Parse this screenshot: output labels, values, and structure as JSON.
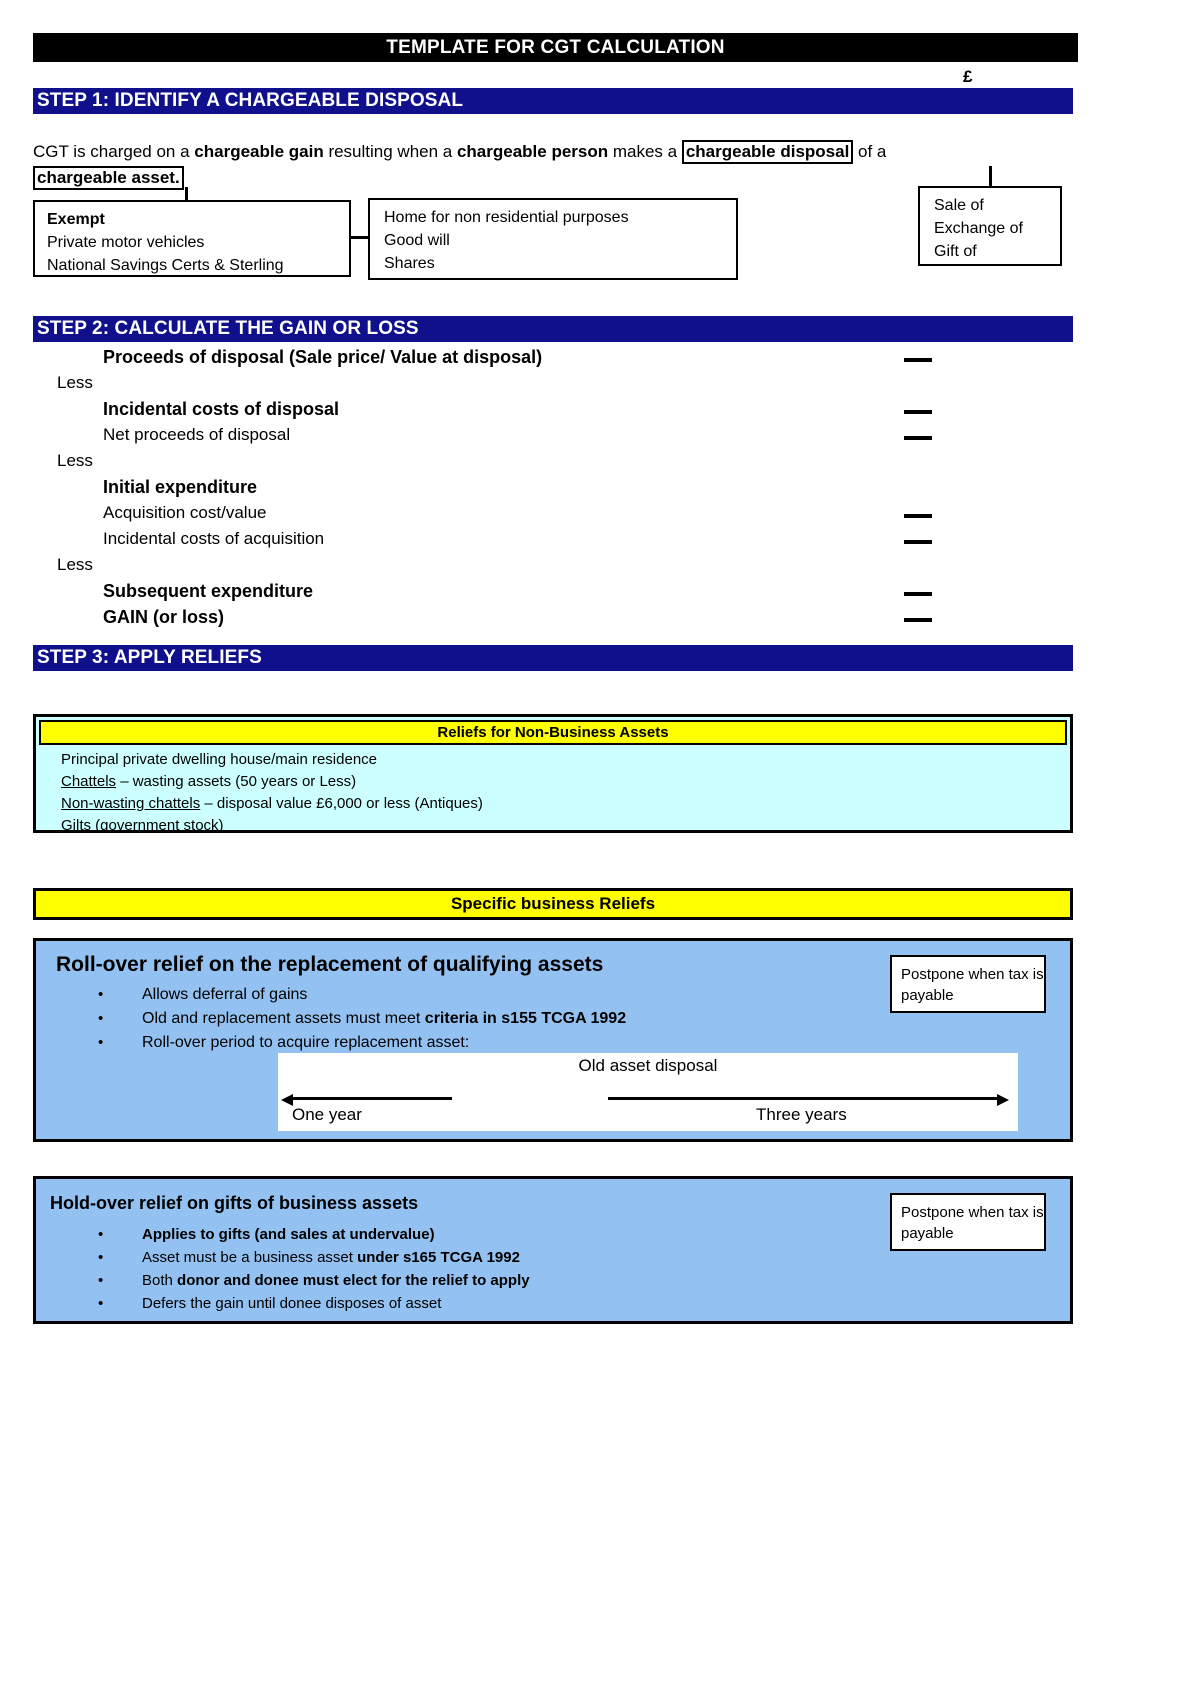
{
  "document": {
    "title": "TEMPLATE FOR CGT CALCULATION",
    "currency_symbol": "£"
  },
  "step1": {
    "heading": "STEP 1: IDENTIFY A CHARGEABLE DISPOSAL",
    "intro": {
      "p1": "CGT is charged on a ",
      "b1": "chargeable gain",
      "p2": " resulting when a ",
      "b2": "chargeable person",
      "p3": " makes a ",
      "boxed1": "chargeable disposal",
      "p4": " of a ",
      "boxed2": "chargeable asset."
    },
    "exempt_box": {
      "heading": "Exempt",
      "items": [
        "Private motor vehicles",
        "National Savings Certs & Sterling"
      ]
    },
    "home_box": {
      "items": [
        "Home for non residential purposes",
        "Good will",
        "Shares"
      ]
    },
    "disposal_box": {
      "items": [
        "Sale of",
        "Exchange of",
        "Gift of"
      ]
    }
  },
  "step2": {
    "heading": "STEP 2: CALCULATE THE GAIN OR LOSS",
    "rows": [
      {
        "less": "",
        "item": "Proceeds of disposal (Sale price/ Value at disposal)",
        "bold": true,
        "rule": true
      },
      {
        "less": "Less",
        "item": "",
        "bold": false,
        "rule": false
      },
      {
        "less": "",
        "item": "Incidental costs of disposal",
        "bold": true,
        "rule": true
      },
      {
        "less": "",
        "item": "Net proceeds of disposal",
        "bold": false,
        "rule": true
      },
      {
        "less": "Less",
        "item": "",
        "bold": false,
        "rule": false
      },
      {
        "less": "",
        "item": "Initial expenditure",
        "bold": true,
        "rule": false
      },
      {
        "less": "",
        "item": "Acquisition cost/value",
        "bold": false,
        "rule": true
      },
      {
        "less": "",
        "item": "Incidental costs of acquisition",
        "bold": false,
        "rule": true
      },
      {
        "less": "Less",
        "item": "",
        "bold": false,
        "rule": false
      },
      {
        "less": "",
        "item": "Subsequent expenditure",
        "bold": true,
        "rule": true
      },
      {
        "less": "",
        "item": "GAIN (or loss)",
        "bold": true,
        "rule": true
      }
    ]
  },
  "step3": {
    "heading": "STEP 3: APPLY RELIEFS",
    "non_business": {
      "title": "Reliefs for Non-Business Assets",
      "items": [
        {
          "underlined": "",
          "text": "Principal private dwelling house/main residence"
        },
        {
          "underlined": "Chattels",
          "text": " – wasting assets (50 years or Less)"
        },
        {
          "underlined": "Non-wasting chattels",
          "text": " – disposal value £6,000 or less (Antiques)"
        },
        {
          "underlined": "",
          "text": "Gilts (government stock)"
        }
      ]
    },
    "business_bar": "Specific business Reliefs",
    "rollover": {
      "title": "Roll-over relief on the replacement of qualifying assets",
      "bullets": [
        {
          "plain": "Allows deferral of gains",
          "bold": ""
        },
        {
          "plain": "Old and replacement assets must meet ",
          "bold": "criteria in s155 TCGA 1992"
        },
        {
          "plain": "Roll-over period to acquire replacement asset:",
          "bold": ""
        }
      ],
      "postpone": "Postpone when tax is payable",
      "timeline": {
        "title": "Old asset disposal",
        "left_label": "One year",
        "right_label": "Three years"
      }
    },
    "holdover": {
      "title": "Hold-over relief on gifts of business assets",
      "bullets": [
        {
          "plain": "",
          "bold": "Applies to gifts (and sales at undervalue)"
        },
        {
          "plain": "Asset must be a business asset ",
          "bold": "under s165 TCGA 1992"
        },
        {
          "plain": "Both ",
          "bold": "donor and donee must elect for the relief to apply"
        },
        {
          "plain": "Defers the gain until donee disposes of asset",
          "bold": ""
        }
      ],
      "postpone": "Postpone when tax is payable"
    }
  },
  "colors": {
    "title_bg": "#000000",
    "step_bar_bg": "#10108c",
    "yellow": "#ffff00",
    "cyan": "#ccffff",
    "blue_panel": "#93c2f2"
  }
}
